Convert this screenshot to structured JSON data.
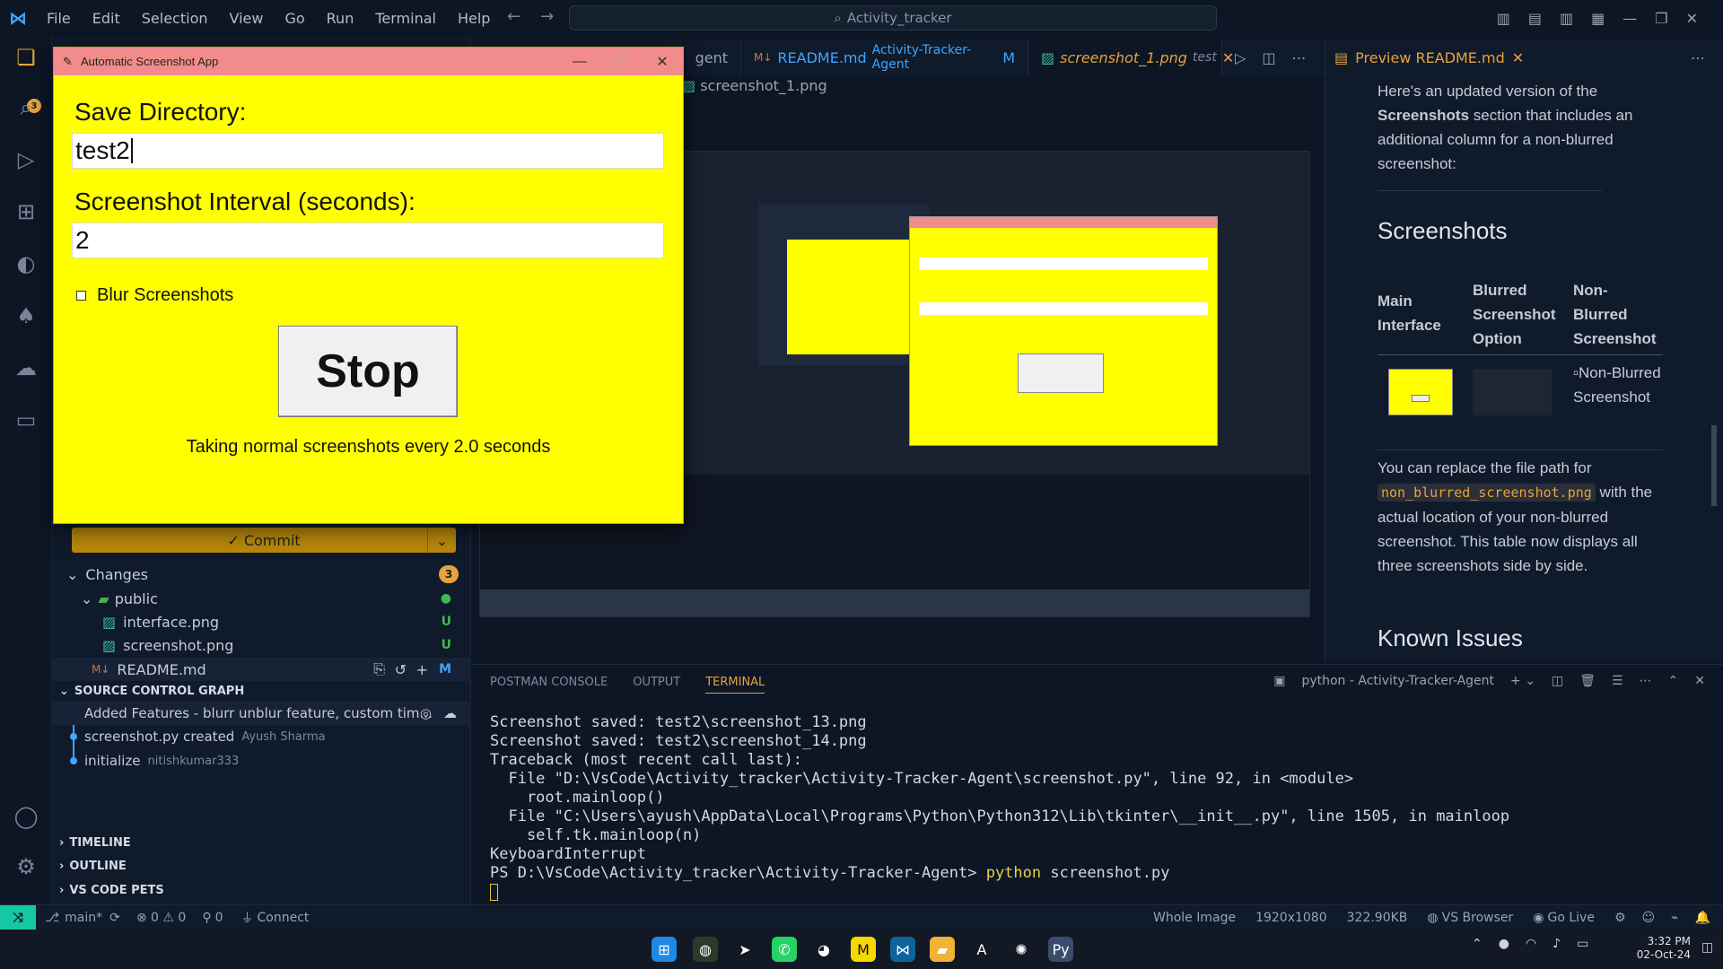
{
  "titlebar": {
    "menu": [
      "File",
      "Edit",
      "Selection",
      "View",
      "Go",
      "Run",
      "Terminal",
      "Help"
    ],
    "search_text": "Activity_tracker"
  },
  "activity_bar": {
    "scm_badge": "3"
  },
  "sidebar": {
    "commit_label": "✓ Commit",
    "changes_label": "Changes",
    "changes_count": "3",
    "folder": "public",
    "files": [
      {
        "name": "interface.png",
        "status": "U"
      },
      {
        "name": "screenshot.png",
        "status": "U"
      },
      {
        "name": "README.md",
        "status": "M"
      }
    ],
    "graph_title": "SOURCE CONTROL GRAPH",
    "graph": [
      {
        "message": "Added Features - blurr unblur feature, custom tim...",
        "author": ""
      },
      {
        "message": "screenshot.py created",
        "author": "Ayush Sharma"
      },
      {
        "message": "initialize",
        "author": "nitishkumar333"
      }
    ],
    "sections": [
      "TIMELINE",
      "OUTLINE",
      "VS CODE PETS"
    ]
  },
  "editor": {
    "tabs": [
      {
        "label": "gent",
        "sub": ""
      },
      {
        "label": "README.md",
        "sub": "Activity-Tracker-Agent",
        "status": "M"
      },
      {
        "label": "screenshot_1.png",
        "sub": "test"
      }
    ],
    "breadcrumb": "screenshot_1.png"
  },
  "preview": {
    "tab_label": "Preview README.md",
    "intro_1": "Here's an updated version of the",
    "intro_bold": "Screenshots",
    "intro_2": "section that includes an additional column for a non-blurred screenshot:",
    "heading": "Screenshots",
    "col_1": "Main Interface",
    "col_2": "Blurred Screenshot Option",
    "col_3": "Non-Blurred Screenshot",
    "alt_text": "Non-Blurred Screenshot",
    "para_1": "You can replace the file path for",
    "code": "non_blurred_screenshot.png",
    "para_2": "with the actual location of your non-blurred screenshot. This table now displays all three screenshots side by side.",
    "heading_2": "Known Issues"
  },
  "panel": {
    "tabs": [
      "POSTMAN CONSOLE",
      "OUTPUT",
      "TERMINAL"
    ],
    "terminal_name": "python - Activity-Tracker-Agent",
    "lines": [
      "Screenshot saved: test2\\screenshot_13.png",
      "Screenshot saved: test2\\screenshot_14.png",
      "Traceback (most recent call last):",
      "  File \"D:\\VsCode\\Activity_tracker\\Activity-Tracker-Agent\\screenshot.py\", line 92, in <module>",
      "    root.mainloop()",
      "  File \"C:\\Users\\ayush\\AppData\\Local\\Programs\\Python\\Python312\\Lib\\tkinter\\__init__.py\", line 1505, in mainloop",
      "    self.tk.mainloop(n)",
      "KeyboardInterrupt"
    ],
    "prompt": "PS D:\\VsCode\\Activity_tracker\\Activity-Tracker-Agent>",
    "command_1": "python",
    "command_2": "screenshot.py"
  },
  "statusbar": {
    "branch": "main*",
    "errors": "⊗ 0 ⚠ 0",
    "ports": "0",
    "connect": "Connect",
    "whole_image": "Whole Image",
    "resolution": "1920x1080",
    "filesize": "322.90KB",
    "browser": "VS Browser",
    "golive": "Go Live"
  },
  "taskbar": {
    "time": "3:32 PM",
    "date": "02-Oct-24"
  },
  "app": {
    "title": "Automatic Screenshot App",
    "save_dir_label": "Save Directory:",
    "save_dir_value": "test2",
    "interval_label": "Screenshot Interval (seconds):",
    "interval_value": "2",
    "blur_label": "Blur Screenshots",
    "blur_checked": false,
    "stop_label": "Stop",
    "status": "Taking normal screenshots every 2.0 seconds"
  }
}
